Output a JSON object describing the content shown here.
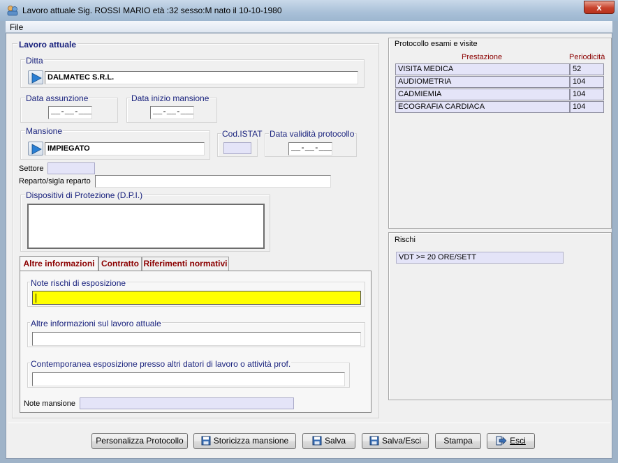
{
  "window": {
    "title": "Lavoro attuale Sig. ROSSI MARIO età :32 sesso:M nato il 10-10-1980",
    "close_label": "x"
  },
  "menu": {
    "file": "File"
  },
  "lavoro": {
    "heading": "Lavoro attuale",
    "ditta": {
      "label": "Ditta",
      "value": "DALMATEC S.R.L."
    },
    "data_assunzione": {
      "label": "Data assunzione",
      "value": "__-__-____"
    },
    "data_inizio_mansione": {
      "label": "Data inizio mansione",
      "value": "__-__-____"
    },
    "mansione": {
      "label": "Mansione",
      "value": "IMPIEGATO"
    },
    "cod_istat": {
      "label": "Cod.ISTAT",
      "value": ""
    },
    "data_validita": {
      "label": "Data validità protocollo",
      "value": "__-__-____"
    },
    "settore": {
      "label": "Settore",
      "value": ""
    },
    "reparto": {
      "label": "Reparto/sigla reparto",
      "value": ""
    },
    "dpi": {
      "label": "Dispositivi di Protezione (D.P.I.)",
      "value": ""
    }
  },
  "tabs": [
    "Altre informazioni",
    "Contratto",
    "Riferimenti normativi"
  ],
  "altre": {
    "note_rischi_label": "Note rischi di esposizione",
    "altre_info_label": "Altre informazioni sul lavoro attuale",
    "contemporanea_label": "Contemporanea esposizione presso altri datori di lavoro o attività prof.",
    "note_mansione_label": "Note mansione"
  },
  "protocollo": {
    "title": "Protocollo esami e visite",
    "col_prestazione": "Prestazione",
    "col_periodicita": "Periodicità",
    "rows": [
      {
        "prestazione": "VISITA MEDICA",
        "periodicita": "52"
      },
      {
        "prestazione": "AUDIOMETRIA",
        "periodicita": "104"
      },
      {
        "prestazione": "CADMIEMIA",
        "periodicita": "104"
      },
      {
        "prestazione": "ECOGRAFIA CARDIACA",
        "periodicita": "104"
      }
    ]
  },
  "rischi": {
    "title": "Rischi",
    "items": [
      "VDT >= 20 ORE/SETT"
    ]
  },
  "buttons": {
    "personalizza": "Personalizza Protocollo",
    "storicizza": "Storicizza mansione",
    "salva": "Salva",
    "salva_esci": "Salva/Esci",
    "stampa": "Stampa",
    "esci": "Esci"
  },
  "colors": {
    "accent_title": "#1a237e",
    "tab_text": "#8b0000",
    "highlight": "#ffff00",
    "grid_bg": "#e4e4f8"
  }
}
